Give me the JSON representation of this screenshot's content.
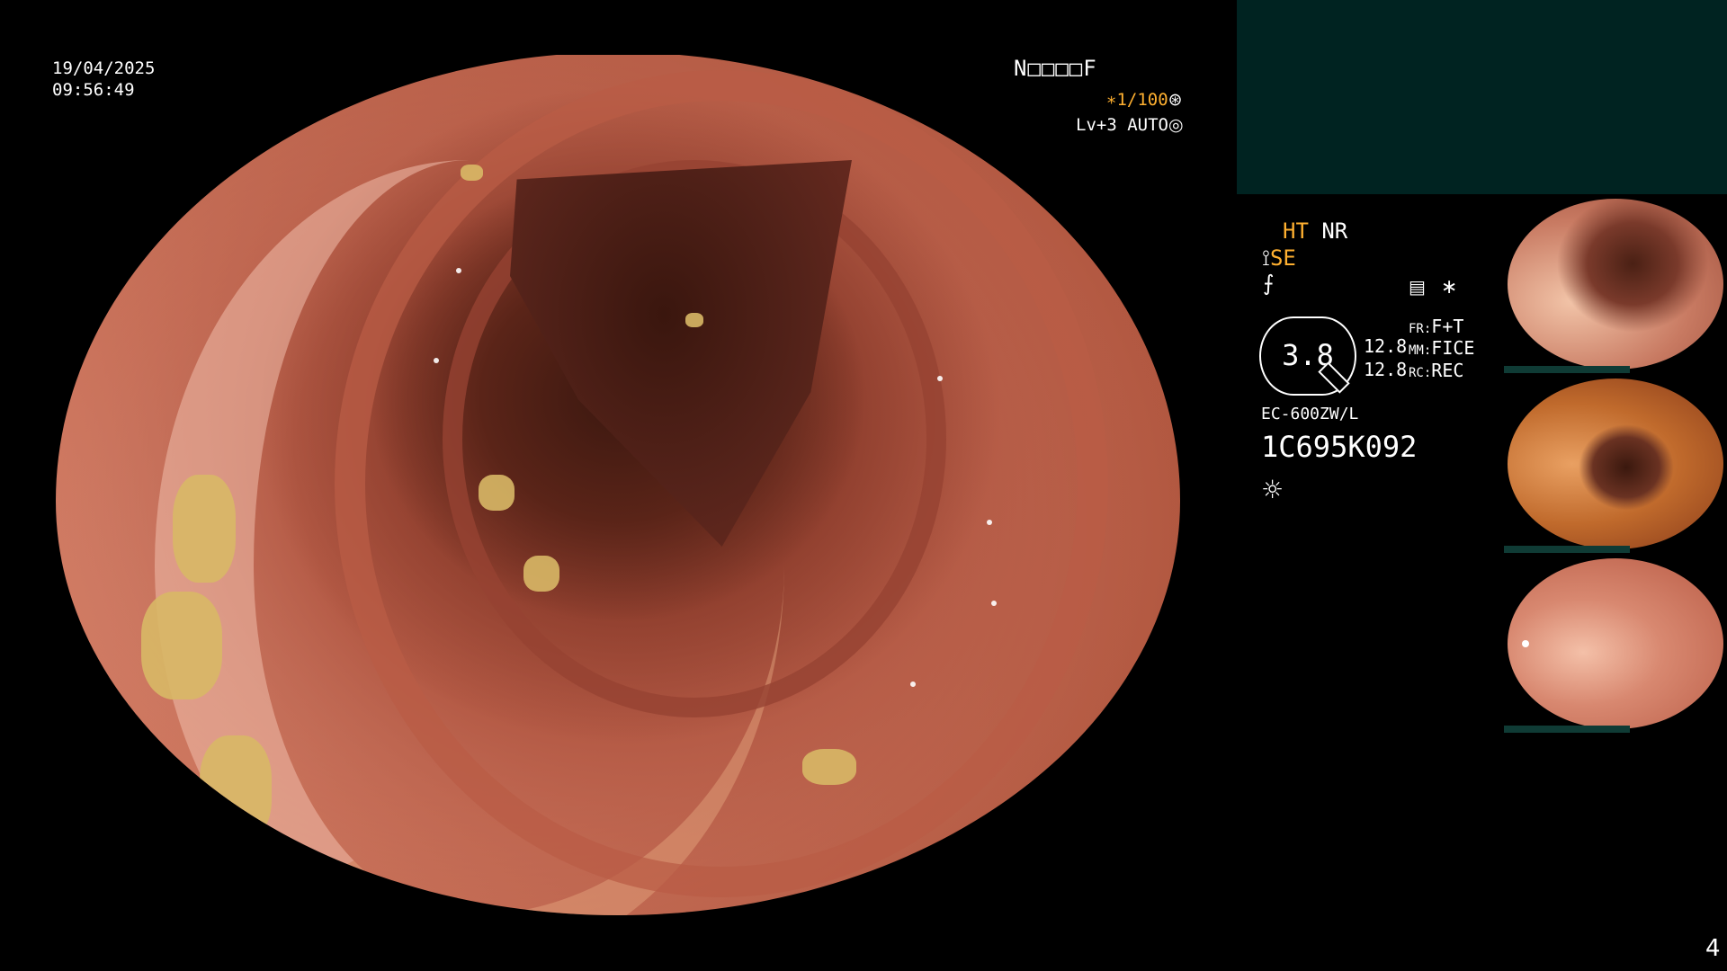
{
  "overlay": {
    "date": "19/04/2025",
    "time": "09:56:49",
    "patient_id": "N□□□□F",
    "shutter": "∗1/100",
    "shutter_icon": "aperture-icon",
    "level": "Lv+3 AUTO",
    "level_icon": "iris-icon"
  },
  "info": {
    "ht_label": "HT",
    "nr_label": "NR",
    "se_label": "SE",
    "zoom_value": "3.8",
    "value_1": "12.8",
    "value_2": "12.8",
    "fr_key": "FR:",
    "fr_value": "F+T",
    "mm_key": "MM:",
    "mm_value": "FICE",
    "rc_key": "RC:",
    "rc_value": "REC",
    "scope_model": "EC-600ZW/L",
    "scope_serial": "1C695K092"
  },
  "thumbnails": [
    {
      "name": "captured-image-1"
    },
    {
      "name": "captured-image-2"
    },
    {
      "name": "captured-image-3"
    }
  ],
  "page_number": "4"
}
